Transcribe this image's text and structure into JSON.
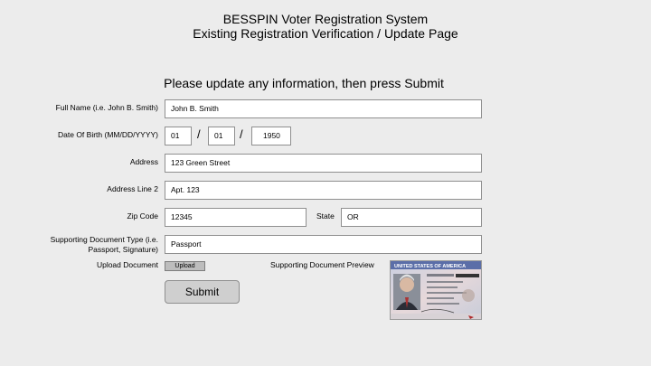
{
  "header": {
    "title_line1": "BESSPIN Voter Registration System",
    "title_line2": "Existing Registration Verification / Update Page"
  },
  "instructions": "Please update any information, then press Submit",
  "form": {
    "full_name": {
      "label": "Full Name (i.e. John B. Smith)",
      "value": "John B. Smith"
    },
    "dob": {
      "label": "Date Of Birth (MM/DD/YYYY)",
      "month": "01",
      "day": "01",
      "year": "1950",
      "separator": "/"
    },
    "address": {
      "label": "Address",
      "value": "123 Green Street"
    },
    "address2": {
      "label": "Address Line 2",
      "value": "Apt. 123"
    },
    "zip": {
      "label": "Zip Code",
      "value": "12345"
    },
    "state": {
      "label": "State",
      "value": "OR"
    },
    "doc_type": {
      "label_line1": "Supporting Document Type (i.e.",
      "label_line2": "Passport, Signature)",
      "value": "Passport"
    },
    "upload": {
      "label": "Upload Document",
      "button": "Upload"
    },
    "preview": {
      "label": "Supporting Document Preview",
      "doc_lettering": "UNITED STATES OF AMERICA"
    },
    "submit": "Submit"
  }
}
